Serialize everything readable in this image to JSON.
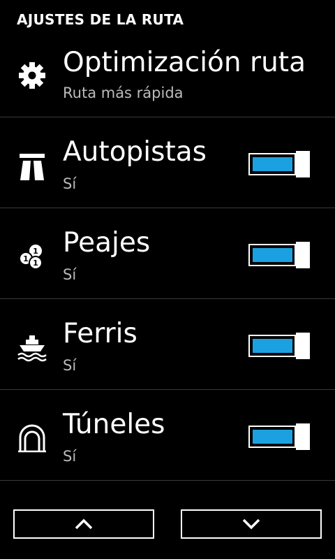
{
  "header": {
    "title": "AJUSTES DE LA RUTA"
  },
  "settings": [
    {
      "icon": "gear-icon",
      "title": "Optimización ruta",
      "value": "Ruta más rápida",
      "has_toggle": false
    },
    {
      "icon": "highway-icon",
      "title": "Autopistas",
      "value": "Sí",
      "has_toggle": true,
      "enabled": true
    },
    {
      "icon": "coins-icon",
      "title": "Peajes",
      "value": "Sí",
      "has_toggle": true,
      "enabled": true
    },
    {
      "icon": "ferry-icon",
      "title": "Ferris",
      "value": "Sí",
      "has_toggle": true,
      "enabled": true
    },
    {
      "icon": "tunnel-icon",
      "title": "Túneles",
      "value": "Sí",
      "has_toggle": true,
      "enabled": true
    }
  ],
  "nav": {
    "up_icon": "chevron-up-icon",
    "down_icon": "chevron-down-icon"
  },
  "colors": {
    "background": "#000000",
    "accent": "#1ba1e2",
    "text": "#ffffff",
    "subtext": "#bbbbbb"
  }
}
